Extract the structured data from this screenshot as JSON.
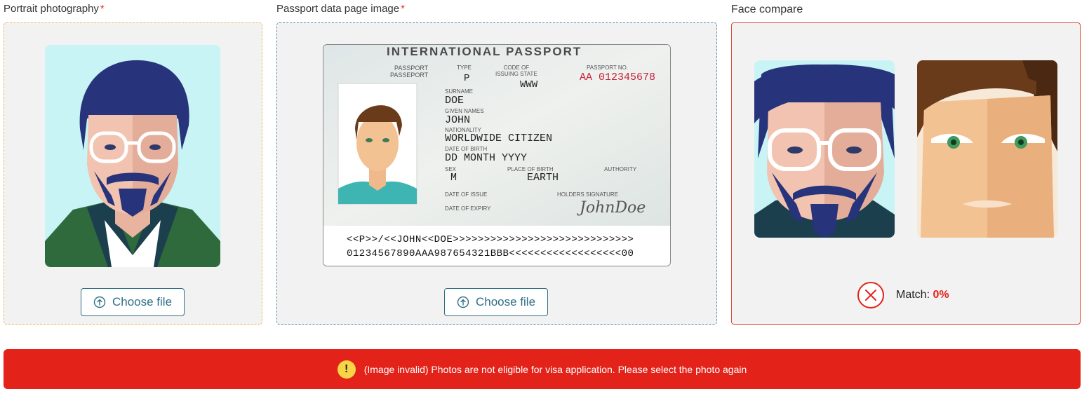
{
  "portrait": {
    "label": "Portrait photography",
    "required_mark": "*",
    "button_label": "Choose file"
  },
  "passport": {
    "label": "Passport data page image",
    "required_mark": "*",
    "button_label": "Choose file",
    "doc": {
      "header": "INTERNATIONAL PASSPORT",
      "passport_label_1": "PASSPORT",
      "passport_label_2": "PASSEPORT",
      "type_label": "TYPE",
      "type_value": "P",
      "code_label_1": "CODE OF",
      "code_label_2": "ISSUING STATE",
      "code_value": "WWW",
      "number_label": "PASSPORT NO.",
      "number_value": "AA 012345678",
      "surname_label": "SURNAME",
      "surname_value": "DOE",
      "given_label": "GIVEN NAMES",
      "given_value": "JOHN",
      "nationality_label": "NATIONALITY",
      "nationality_value": "WORLDWIDE CITIZEN",
      "dob_label": "DATE OF BIRTH",
      "dob_value": "DD MONTH YYYY",
      "sex_label": "SEX",
      "sex_value": "M",
      "pob_label": "PLACE OF BIRTH",
      "pob_value": "EARTH",
      "authority_label": "AUTHORITY",
      "issue_label": "DATE OF ISSUE",
      "holder_sig_label": "HOLDERS SIGNATURE",
      "expiry_label": "DATE OF EXPIRY",
      "signature": "JohnDoe",
      "mrz_line1": "<<P>>/<<JOHN<<DOE>>>>>>>>>>>>>>>>>>>>>>>>>>>>>",
      "mrz_line2": "01234567890AAA987654321BBB<<<<<<<<<<<<<<<<<<00"
    }
  },
  "compare": {
    "label": "Face compare",
    "match_label": "Match: ",
    "match_value": "0%"
  },
  "error": {
    "icon": "!",
    "message": "(Image invalid) Photos are not eligible for visa application. Please select the photo again"
  },
  "colors": {
    "accent": "#2f6f86",
    "error": "#e32219",
    "warning": "#f7d546"
  }
}
